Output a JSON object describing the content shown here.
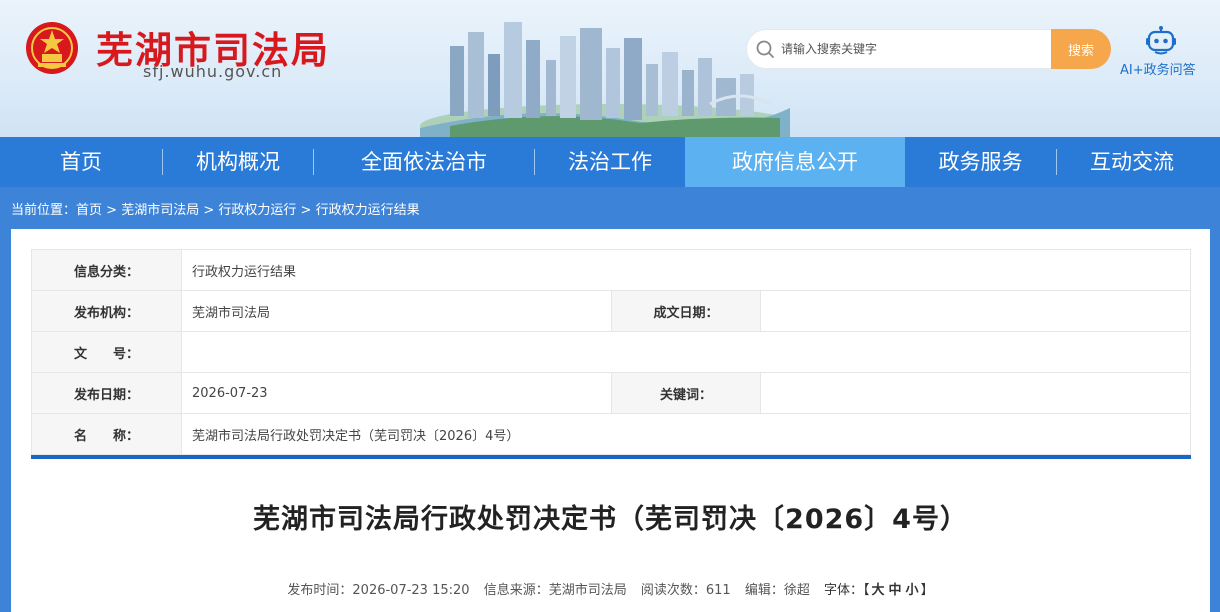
{
  "header": {
    "site_title": "芜湖市司法局",
    "site_domain": "sfj.wuhu.gov.cn",
    "search_placeholder": "请输入搜索关键字",
    "search_button": "搜索",
    "ai_label": "AI+政务问答",
    "emblem_icon": "national-emblem-icon",
    "brand_color": "#d7181d"
  },
  "nav": {
    "items": [
      {
        "label": "首页"
      },
      {
        "label": "机构概况"
      },
      {
        "label": "全面依法治市"
      },
      {
        "label": "法治工作"
      },
      {
        "label": "政府信息公开",
        "active": true
      },
      {
        "label": "政务服务"
      },
      {
        "label": "互动交流"
      }
    ],
    "bg_color": "#2a7ad7",
    "active_color": "#5cb1f0"
  },
  "breadcrumb": {
    "prefix": "当前位置：",
    "items": [
      "首页",
      "芜湖市司法局",
      "行政权力运行",
      "行政权力运行结果"
    ],
    "separator": " > "
  },
  "meta": {
    "category_label": "信息分类：",
    "category_value": "行政权力运行结果",
    "publisher_label": "发布机构：",
    "publisher_value": "芜湖市司法局",
    "written_date_label": "成文日期：",
    "written_date_value": "",
    "doc_no_label": "文　　号：",
    "doc_no_value": "",
    "publish_date_label": "发布日期：",
    "publish_date_value": "2026-07-23",
    "keywords_label": "关键词：",
    "keywords_value": "",
    "name_label": "名　　称：",
    "name_value": "芜湖市司法局行政处罚决定书（芜司罚决〔2026〕4号）"
  },
  "article": {
    "title": "芜湖市司法局行政处罚决定书（芜司罚决〔2026〕4号）",
    "publish_time": "发布时间：2026-07-23 15:20",
    "source": "信息来源：芜湖市司法局",
    "views": "阅读次数：611",
    "editor": "编辑：徐超",
    "font_label": "字体：",
    "font_open": "【",
    "font_large": "大",
    "font_medium": "中",
    "font_small": "小",
    "font_close": "】"
  }
}
